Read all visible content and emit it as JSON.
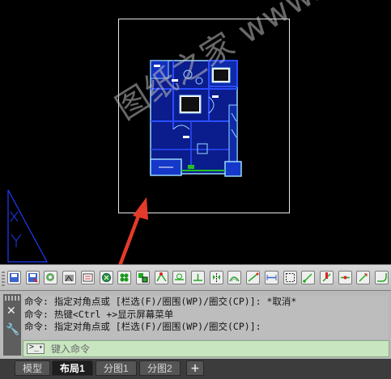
{
  "colors": {
    "canvas_bg": "#000000",
    "paper_border": "#e6e6e6",
    "plan_walls": "#2a4dff",
    "plan_fill": "#0b1c8c",
    "plan_outline": "#9ad8ff",
    "plan_green": "#21c221",
    "ucs_color": "#1f3cff",
    "arrow_color": "#e33a2b",
    "command_input_bg": "#c8e6c0"
  },
  "canvas": {
    "watermark_text": "图纸之家 www.zzzcad.com",
    "drawing_name": "floor-plan",
    "ucs_icon": "ucs-triangle-icon"
  },
  "toolbar": {
    "buttons": [
      {
        "name": "save-icon"
      },
      {
        "name": "save-as-icon"
      },
      {
        "name": "publish-icon"
      },
      {
        "name": "match-properties-icon"
      },
      {
        "name": "print-preview-icon"
      },
      {
        "name": "isolate-icon"
      },
      {
        "name": "circle-grid-icon"
      },
      {
        "name": "layer-state-icon"
      },
      {
        "name": "node-snap-icon"
      },
      {
        "name": "tangent-snap-icon"
      },
      {
        "name": "perpendicular-snap-icon"
      },
      {
        "name": "mirror-icon"
      },
      {
        "name": "offset-icon"
      },
      {
        "name": "measure-icon"
      },
      {
        "name": "dimension-icon"
      },
      {
        "name": "window-select-icon"
      },
      {
        "name": "polyline-edit-icon"
      },
      {
        "name": "break-icon"
      },
      {
        "name": "extend-icon"
      },
      {
        "name": "trim-icon"
      },
      {
        "name": "fillet-icon"
      }
    ]
  },
  "command": {
    "history": [
      "命令: 指定对角点或 [栏选(F)/圈围(WP)/圈交(CP)]: *取消*",
      "命令: 热键<Ctrl +>显示屏幕菜单",
      "命令: 指定对角点或 [栏选(F)/圈围(WP)/圈交(CP)]:"
    ],
    "input_placeholder": "键入命令",
    "prompt_icon": "command-prompt-icon",
    "close_icon": "close-icon",
    "settings_icon": "wrench-icon"
  },
  "tabs": {
    "items": [
      {
        "label": "模型",
        "active": false
      },
      {
        "label": "布局1",
        "active": true
      },
      {
        "label": "分图1",
        "active": false
      },
      {
        "label": "分图2",
        "active": false
      }
    ],
    "add_label": "+"
  }
}
